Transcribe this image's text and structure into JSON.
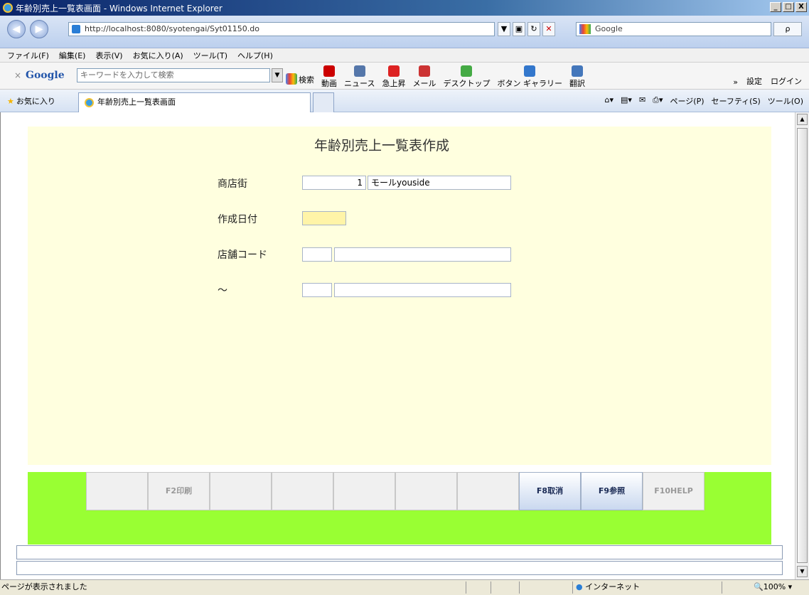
{
  "window": {
    "title": "年齢別売上一覧表画面 - Windows Internet Explorer",
    "minimize": "_",
    "maximize": "□",
    "close": "X"
  },
  "addressbar": {
    "url": "http://localhost:8080/syotengai/Syt01150.do",
    "search_engine": "Google",
    "search_button": "ρ"
  },
  "menu": [
    "ファイル(F)",
    "編集(E)",
    "表示(V)",
    "お気に入り(A)",
    "ツール(T)",
    "ヘルプ(H)"
  ],
  "google_toolbar": {
    "logo": "Google",
    "placeholder": "キーワードを入力して検索",
    "search": "検索",
    "items": [
      {
        "label": "動画",
        "icon": "youtube-icon",
        "color": "#cc0000"
      },
      {
        "label": "ニュース",
        "icon": "news-icon",
        "color": "#5577aa"
      },
      {
        "label": "急上昇",
        "icon": "trending-icon",
        "color": "#dd2222"
      },
      {
        "label": "メール",
        "icon": "gmail-icon",
        "color": "#cc3333"
      },
      {
        "label": "デスクトップ",
        "icon": "desktop-icon",
        "color": "#44aa44"
      },
      {
        "label": "ボタン ギャラリー",
        "icon": "gallery-icon",
        "color": "#3377cc"
      },
      {
        "label": "翻訳",
        "icon": "translate-icon",
        "color": "#4477bb"
      }
    ],
    "more": "»",
    "settings": "設定",
    "login": "ログイン"
  },
  "tabs": {
    "favorites": "お気に入り",
    "active_tab": "年齢別売上一覧表画面",
    "commands": [
      "ページ(P)",
      "セーフティ(S)",
      "ツール(O)"
    ]
  },
  "form": {
    "title": "年齢別売上一覧表作成",
    "shopping_street_label": "商店街",
    "shopping_street_code": "1",
    "shopping_street_name": "モールyouside",
    "date_label": "作成日付",
    "date_value": "",
    "store_code_label": "店舗コード",
    "store_code_from": "",
    "store_name_from": "",
    "range_label": "～",
    "store_code_to": "",
    "store_name_to": ""
  },
  "fkeys": [
    {
      "label": "",
      "active": false
    },
    {
      "label": "F2印刷",
      "active": false
    },
    {
      "label": "",
      "active": false
    },
    {
      "label": "",
      "active": false
    },
    {
      "label": "",
      "active": false
    },
    {
      "label": "",
      "active": false
    },
    {
      "label": "",
      "active": false
    },
    {
      "label": "F8取消",
      "active": true
    },
    {
      "label": "F9参照",
      "active": true
    },
    {
      "label": "F10HELP",
      "active": false
    }
  ],
  "colors": {
    "form_background": "#ffffdf",
    "fkey_background": "#99ff33",
    "date_field": "#fff4a8"
  },
  "statusbar": {
    "text": "ページが表示されました",
    "zone": "インターネット",
    "zoom": "100%"
  }
}
